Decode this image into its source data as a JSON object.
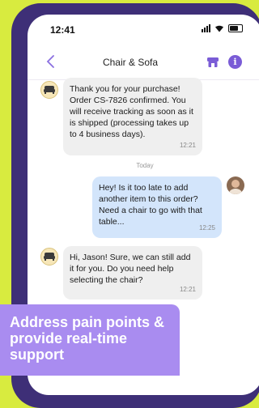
{
  "status_bar": {
    "time": "12:41"
  },
  "header": {
    "title": "Chair & Sofa",
    "info_glyph": "i"
  },
  "messages": [
    {
      "sender": "bot",
      "text": "Thank you for your purchase! Order CS-7826 confirmed. You will receive tracking as soon as it is shipped (processing takes up to 4 business days).",
      "time": "12:21"
    },
    {
      "sender": "user",
      "text": "Hey! Is it too late to add another item to this order? Need a chair to go with that table...",
      "time": "12:25"
    },
    {
      "sender": "bot",
      "text": "Hi, Jason! Sure, we can still add it for you. Do you need help selecting the chair?",
      "time": "12:21"
    }
  ],
  "day_separator": "Today",
  "banner": {
    "text": "Address pain points & provide real-time support"
  },
  "colors": {
    "background": "#d8eb3f",
    "phone_frame": "#3e2f77",
    "accent": "#7a5cd6",
    "banner": "#a98cf0",
    "outgoing_bubble": "#d3e5fb",
    "incoming_bubble": "#efefef"
  }
}
